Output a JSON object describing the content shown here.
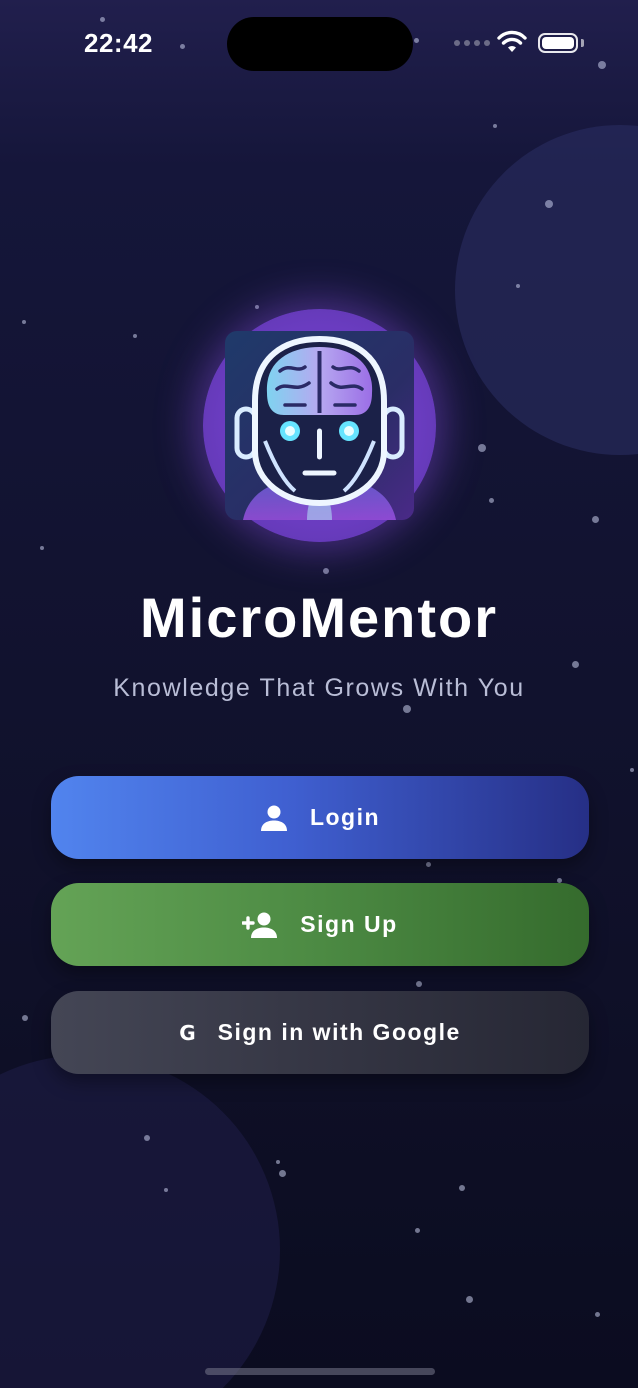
{
  "status_bar": {
    "time": "22:42",
    "wifi_icon": "wifi-icon",
    "battery_icon": "battery-icon"
  },
  "app": {
    "logo_icon": "robot-brain-logo",
    "title": "MicroMentor",
    "tagline": "Knowledge That Grows With You"
  },
  "buttons": {
    "login": {
      "label": "Login",
      "icon": "person-icon",
      "color": "#4f78e6"
    },
    "signup": {
      "label": "Sign Up",
      "icon": "person-add-icon",
      "color": "#5a9a4e"
    },
    "google": {
      "label": "Sign in with Google",
      "icon": "google-g-icon",
      "icon_text": "G",
      "color": "#3a3b48"
    }
  },
  "colors": {
    "background": "#121331",
    "accent_glow": "#7c4bd0"
  }
}
